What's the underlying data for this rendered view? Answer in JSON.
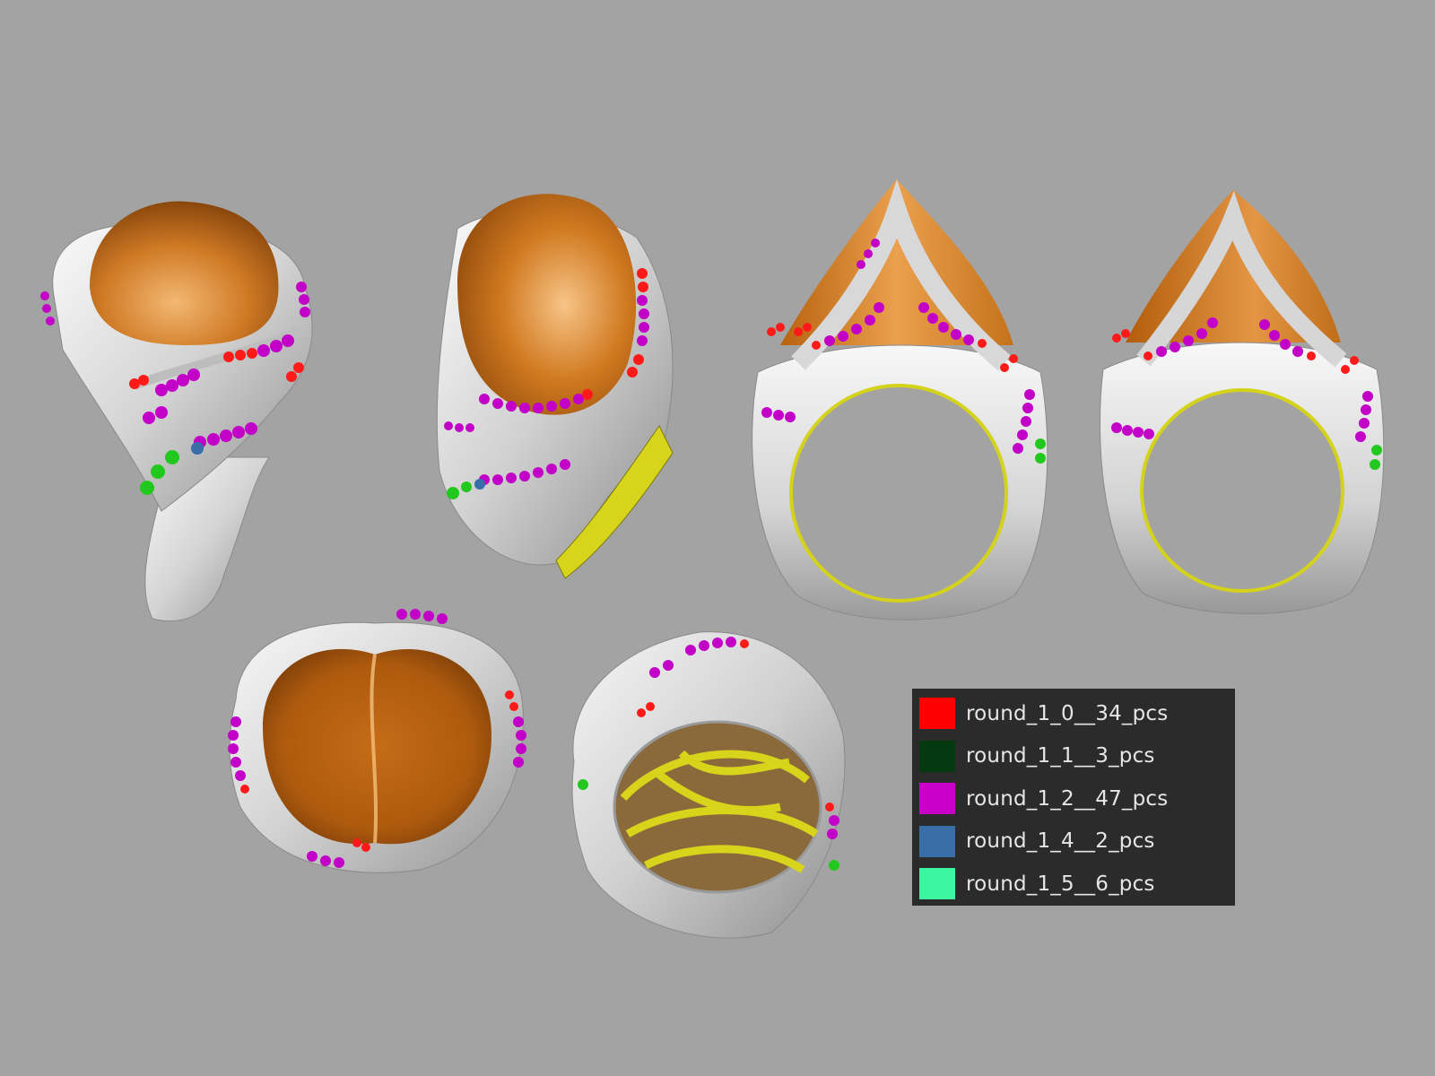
{
  "colors": {
    "background": "#a3a3a3",
    "metal": "#e2e2e2",
    "center_stone": "#c9701c",
    "gallery": "#d8d41c",
    "legend_bg": "#2b2b2b"
  },
  "views": [
    {
      "name": "top-tilted-view"
    },
    {
      "name": "three-quarter-view"
    },
    {
      "name": "front-view"
    },
    {
      "name": "front-angled-view"
    },
    {
      "name": "top-down-view"
    },
    {
      "name": "underside-view"
    }
  ],
  "legend": {
    "items": [
      {
        "label": "round_1_0__34_pcs",
        "color": "#ff0000"
      },
      {
        "label": "round_1_1__3_pcs",
        "color": "#053a10"
      },
      {
        "label": "round_1_2__47_pcs",
        "color": "#c800c8"
      },
      {
        "label": "round_1_4__2_pcs",
        "color": "#3a6ea8"
      },
      {
        "label": "round_1_5__6_pcs",
        "color": "#3cf5a0"
      }
    ]
  }
}
